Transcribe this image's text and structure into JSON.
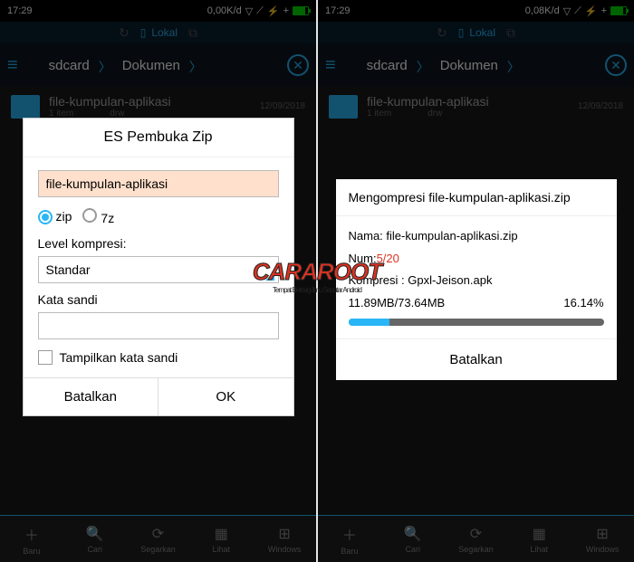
{
  "status": {
    "time": "17:29",
    "dataL": "0,00K/d",
    "dataR": "0,08K/d"
  },
  "toolbar": {
    "local": "Lokal"
  },
  "path": {
    "p1": "sdcard",
    "p2": "Dokumen"
  },
  "file": {
    "name": "file-kumpulan-aplikasi",
    "items": "1 item",
    "perm": "drw",
    "date": "12/09/2018"
  },
  "nav": {
    "baru": "Baru",
    "cari": "Cari",
    "segarkan": "Segarkan",
    "lihat": "Lihat",
    "windows": "Windows"
  },
  "dialog1": {
    "title": "ES Pembuka Zip",
    "filename": "file-kumpulan-aplikasi",
    "fmt_zip": "zip",
    "fmt_7z": "7z",
    "level_label": "Level kompresi:",
    "level_value": "Standar",
    "password_label": "Kata sandi",
    "show_password": "Tampilkan kata sandi",
    "cancel": "Batalkan",
    "ok": "OK"
  },
  "dialog2": {
    "title": "Mengompresi file-kumpulan-aplikasi.zip",
    "name_label": "Nama: ",
    "name_value": "file-kumpulan-aplikasi.zip",
    "num_label": "Num:",
    "num_value": "5/20",
    "compress_label": "Kompresi : ",
    "compress_value": "Gpxl-Jeison.apk",
    "size": "11.89MB/73.64MB",
    "percent": "16.14%",
    "cancel": "Batalkan"
  },
  "watermark": {
    "text": "CARAROOT",
    "sub": "Tempat Berbagi Ilmu Seputar Android"
  }
}
